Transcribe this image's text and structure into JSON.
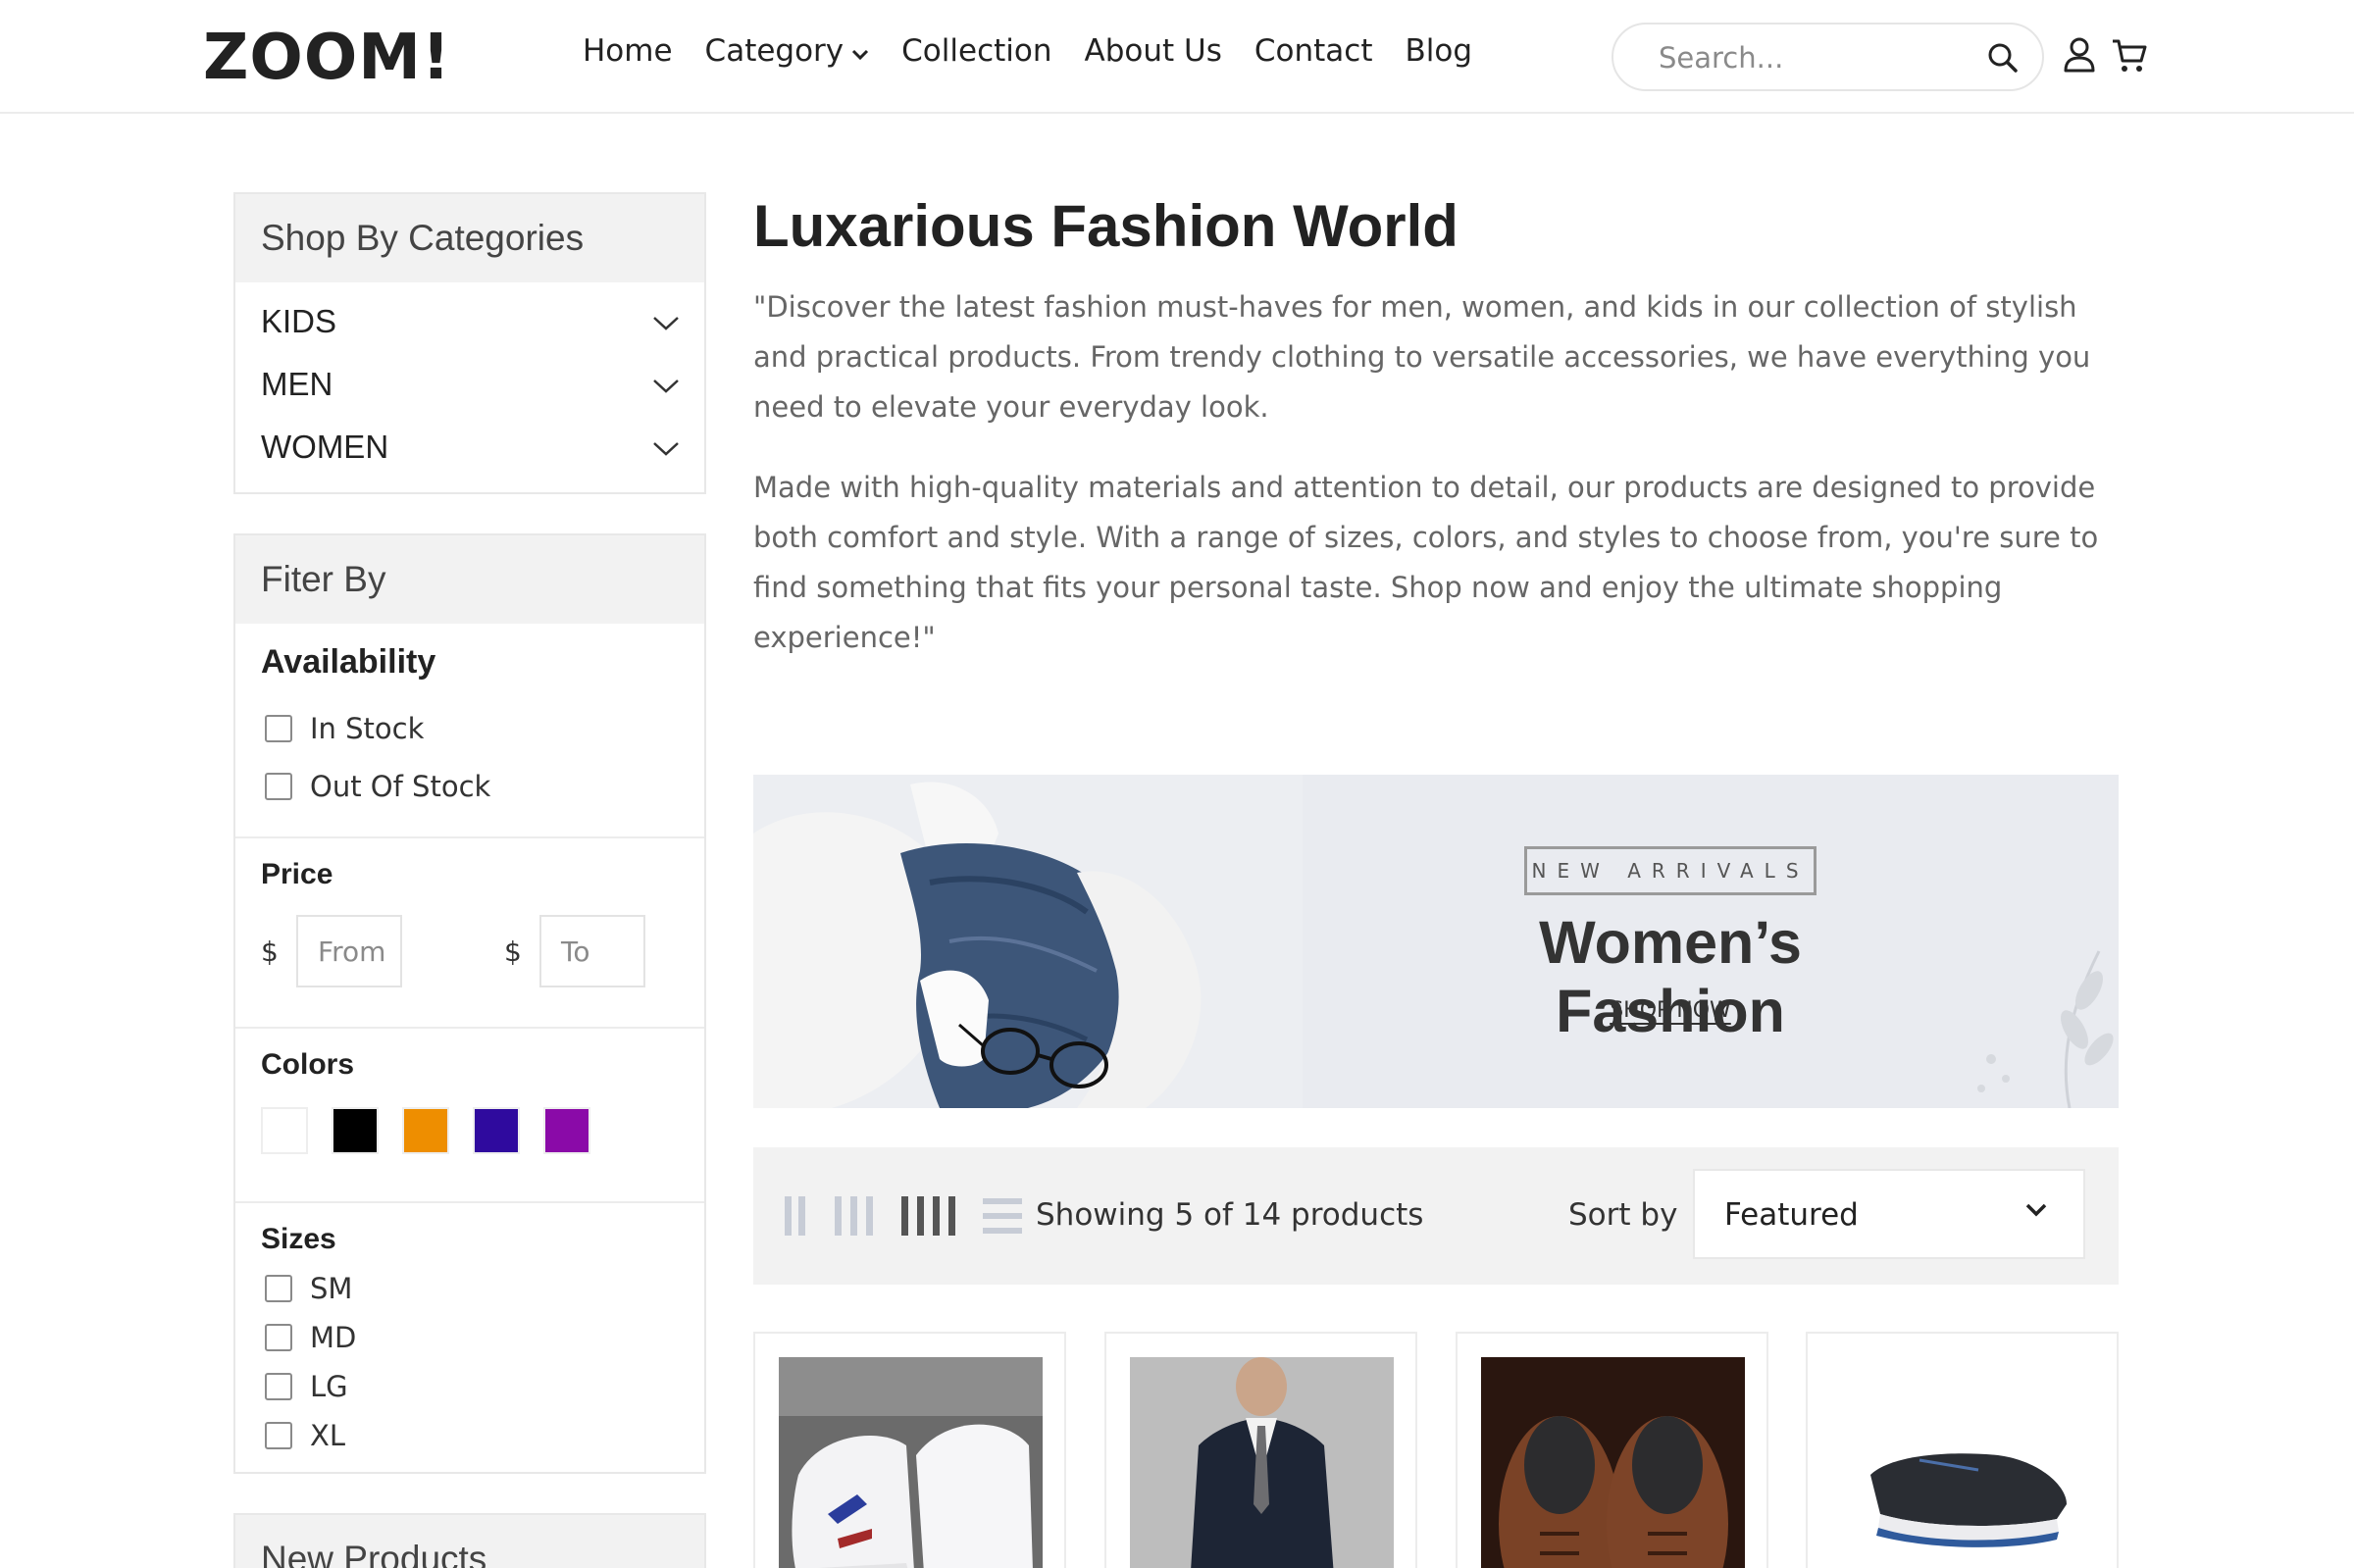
{
  "header": {
    "logo": "ZOOM!",
    "nav": [
      "Home",
      "Category",
      "Collection",
      "About Us",
      "Contact",
      "Blog"
    ],
    "search_placeholder": "Search..."
  },
  "sidebar": {
    "categories_title": "Shop By Categories",
    "categories": [
      "KIDS",
      "MEN",
      "WOMEN"
    ],
    "filter_title": "Fiter By",
    "availability": {
      "title": "Availability",
      "options": [
        "In Stock",
        "Out Of Stock"
      ]
    },
    "price": {
      "title": "Price",
      "currency": "$",
      "from_placeholder": "From",
      "to_placeholder": "To"
    },
    "colors": {
      "title": "Colors",
      "swatches": [
        "#ffffff",
        "#000000",
        "#ee8e00",
        "#2f0a9e",
        "#8a0aa8"
      ]
    },
    "sizes": {
      "title": "Sizes",
      "options": [
        "SM",
        "MD",
        "LG",
        "XL"
      ]
    },
    "new_products_title": "New Products"
  },
  "main": {
    "title": "Luxarious Fashion World",
    "desc1": "\"Discover the latest fashion must-haves for men, women, and kids in our collection of stylish and practical products. From trendy clothing to versatile accessories, we have everything you need to elevate your everyday look.",
    "desc2": "Made with high-quality materials and attention to detail, our products are designed to provide both comfort and style. With a range of sizes, colors, and styles to choose from, you're sure to find something that fits your personal taste. Shop now and enjoy the ultimate shopping experience!\"",
    "banner": {
      "tag": "NEW ARRIVALS",
      "title": "Women’s Fashion",
      "cta": "SHOP NOW"
    },
    "toolbar": {
      "showing": "Showing 5 of 14 products",
      "sort_label": "Sort by",
      "sort_value": "Featured"
    }
  }
}
